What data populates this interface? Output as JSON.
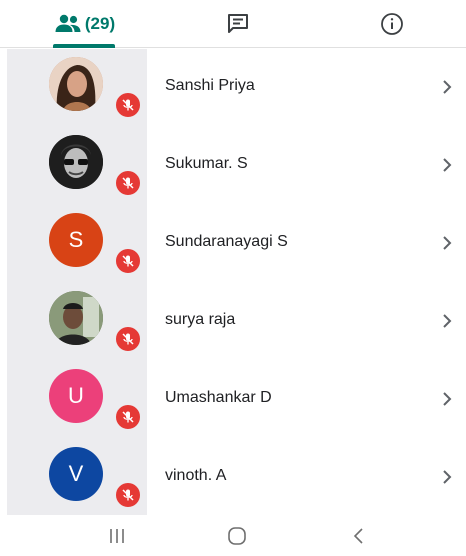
{
  "tabs": {
    "participants_count": "(29)"
  },
  "participants": [
    {
      "name": "Sanshi Priya",
      "initial": "",
      "avatar": "photo",
      "color": "#c48a6a"
    },
    {
      "name": "Sukumar. S",
      "initial": "",
      "avatar": "photo",
      "color": "#2b2b2b"
    },
    {
      "name": "Sundaranayagi S",
      "initial": "S",
      "avatar": "initial",
      "color": "#d84315"
    },
    {
      "name": "surya raja",
      "initial": "",
      "avatar": "photo",
      "color": "#5a6b4a"
    },
    {
      "name": "Umashankar D",
      "initial": "U",
      "avatar": "initial",
      "color": "#ec407a"
    },
    {
      "name": "vinoth. A",
      "initial": "V",
      "avatar": "initial",
      "color": "#0d47a1"
    }
  ],
  "colors": {
    "accent": "#00796b",
    "muted_badge": "#e53935"
  },
  "icons": {
    "people_tab": "people-icon",
    "chat_tab": "chat-icon",
    "info_tab": "info-icon",
    "muted": "mic-off-icon",
    "row_arrow": "chevron-right-icon"
  }
}
